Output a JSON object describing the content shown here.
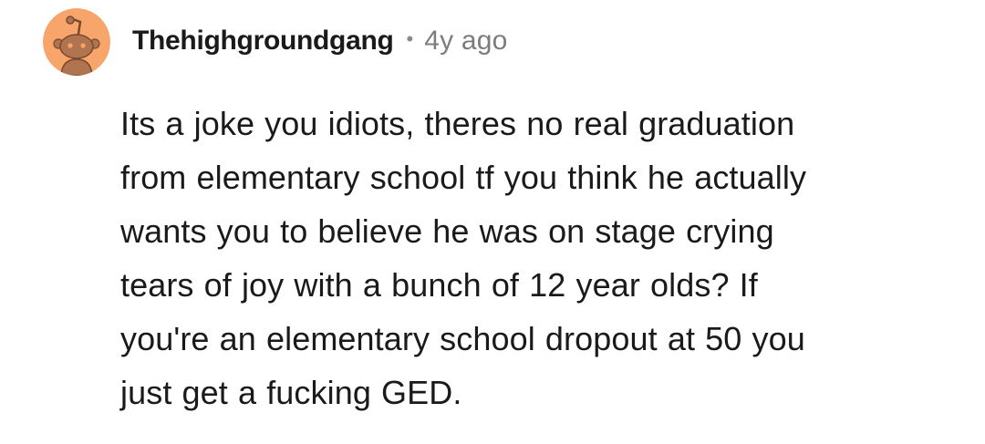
{
  "comment": {
    "avatar_icon": "snoo-avatar-icon",
    "avatar_bg_color": "#f7a56b",
    "username": "Thehighgroundgang",
    "separator": "•",
    "timestamp": "4y ago",
    "body_lines": [
      "Its a joke you idiots, theres no real graduation",
      "from elementary school tf you think he actually",
      "wants you to believe he was on stage crying",
      "tears of joy with a bunch of 12 year olds? If",
      "you're an elementary school dropout at 50 you",
      "just get a fucking GED."
    ]
  }
}
